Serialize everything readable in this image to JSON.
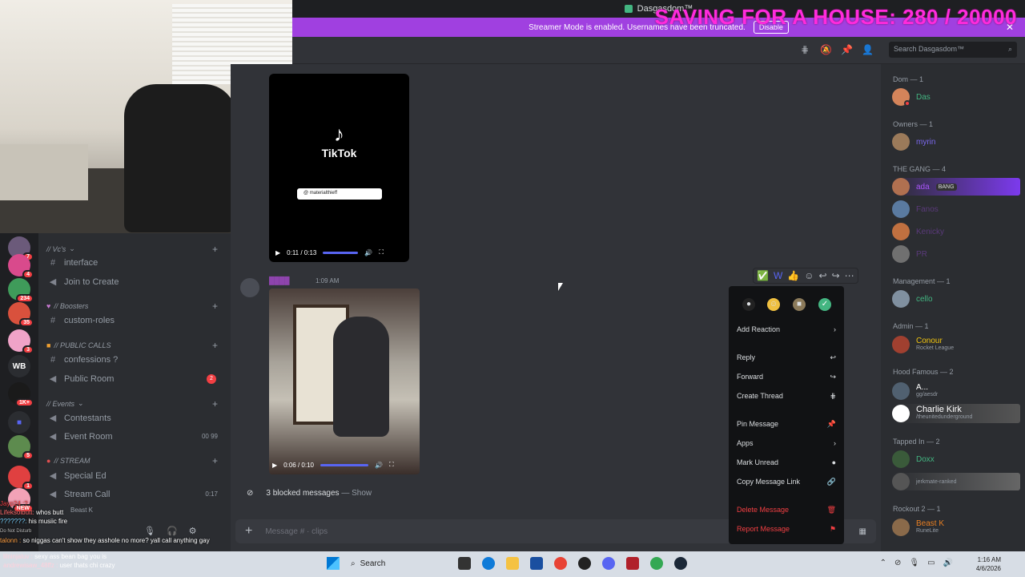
{
  "window": {
    "title": "Dasgasdom™"
  },
  "streamer_banner": {
    "text": "Streamer Mode is enabled. Usernames have been truncated.",
    "button": "Disable"
  },
  "overlay": {
    "text": "SAVING FOR A HOUSE: 280 / 20000"
  },
  "header": {
    "search_placeholder": "Search Dasgasdom™"
  },
  "servers": [
    {
      "label": "",
      "badge": "7"
    },
    {
      "label": "",
      "badge": "4"
    },
    {
      "label": "",
      "badge": "234"
    },
    {
      "label": "",
      "badge": "35"
    },
    {
      "label": "",
      "badge": "3"
    },
    {
      "label": "WB",
      "badge": ""
    },
    {
      "label": "",
      "badge": "1K+"
    },
    {
      "label": "",
      "badge": ""
    },
    {
      "label": "",
      "badge": "5"
    },
    {
      "label": "",
      "badge": "1"
    },
    {
      "label": "",
      "badge": "NEW"
    }
  ],
  "channels": {
    "cat1": "// Vc's",
    "interface": "interface",
    "join_create": "Join to Create",
    "cat_boosters": "// Boosters",
    "custom_roles": "custom-roles",
    "cat_public": "// PUBLIC CALLS",
    "confessions": "confessions ?",
    "public_room": "Public Room",
    "public_room_badge": "2",
    "cat_events": "// Events",
    "contestants": "Contestants",
    "event_room": "Event Room",
    "event_room_counts": "00   99",
    "cat_stream": "// STREAM",
    "special_ed": "Special Ed",
    "stream_call": "Stream Call",
    "stream_call_time": "0:17",
    "beast_k": "Beast K"
  },
  "tiktok": {
    "brand": "TikTok",
    "handle": "@ materialthieff",
    "time": "0:11 / 0:13"
  },
  "message": {
    "time": "1:09 AM",
    "video_time": "0:06 / 0:10"
  },
  "blocked": {
    "text": "3 blocked messages",
    "show": "— Show"
  },
  "composer": {
    "placeholder": "Message # · clips"
  },
  "context_menu": {
    "add_reaction": "Add Reaction",
    "reply": "Reply",
    "forward": "Forward",
    "create_thread": "Create Thread",
    "pin_message": "Pin Message",
    "apps": "Apps",
    "mark_unread": "Mark Unread",
    "copy_link": "Copy Message Link",
    "delete": "Delete Message",
    "report": "Report Message"
  },
  "members": {
    "dom_group": "Dom — 1",
    "das": "Das",
    "owners_group": "Owners — 1",
    "myrin": "myrin",
    "gang_group": "THE GANG — 4",
    "gang_tag": "BANG",
    "fanos": "Fanos",
    "kenicky": "Kenicky",
    "pr": "PR",
    "mgmt_group": "Management — 1",
    "cello": "cello",
    "admin_group": "Admin — 1",
    "conour": "Conour",
    "conour_sub": "Rocket League",
    "hood_group": "Hood Famous — 2",
    "a_name": "A...",
    "a_sub": "gg/aesdr",
    "charlie": "Charlie Kirk",
    "charlie_sub": "/theunitedunderground",
    "tapped_group": "Tapped In — 2",
    "doxx": "Doxx",
    "jerkmate": "jerkmate-ranked",
    "rockout_group": "Rockout 2 — 1",
    "beastk": "Beast K",
    "beastk_sub": "RuneLite"
  },
  "chat": [
    {
      "user": "Lifeksolbutt:",
      "text": "whos butt"
    },
    {
      "user": "???????:",
      "text": "his musiic fire"
    },
    {
      "user": "talonn :",
      "text": "so niggas can't show they asshole no more? yall call anything gay"
    },
    {
      "user": "lilninjaluv :",
      "text": "sexy ass bean bag you is"
    },
    {
      "user": "andrewisaw_48ffz :",
      "text": "user thats chi crazy"
    }
  ],
  "chat_extra": {
    "username_tag": "Jayp24 :?",
    "dnd": "Do Not Disturb"
  },
  "taskbar": {
    "search": "Search",
    "time": "1:16 AM",
    "date": "4/6/2026"
  }
}
